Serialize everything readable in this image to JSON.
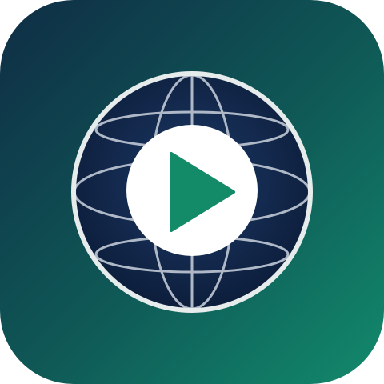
{
  "icon": {
    "name": "globe-play-app-icon",
    "colors": {
      "background_top_left": "#0f2d45",
      "background_mid": "#0f5a57",
      "background_bottom_right": "#128a6c",
      "globe_fill_center": "#1d3a68",
      "globe_fill_edge": "#0d1e3c",
      "globe_ring": "#e6ecec",
      "globe_lines": "#aeb8c6",
      "play_circle": "#ffffff",
      "play_triangle": "#138a68"
    }
  }
}
